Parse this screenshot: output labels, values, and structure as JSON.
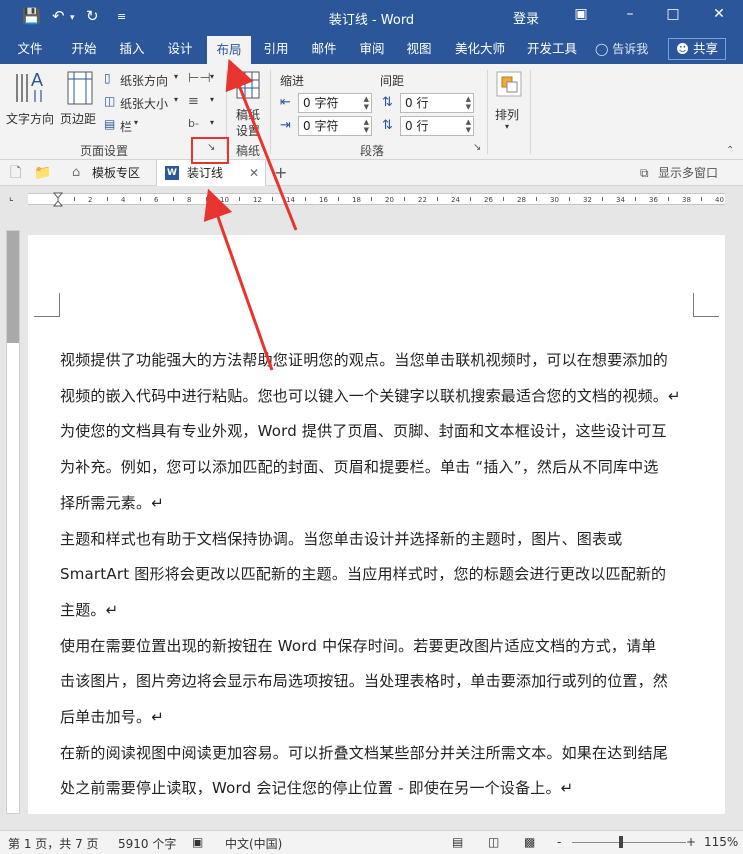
{
  "window": {
    "title": "装订线 - Word",
    "login": "登录",
    "quick_access": {
      "save_icon": "save-icon",
      "undo_icon": "undo-icon",
      "redo_icon": "redo-icon",
      "customize": "customize-icon"
    }
  },
  "tabs": [
    "文件",
    "开始",
    "插入",
    "设计",
    "布局",
    "引用",
    "邮件",
    "审阅",
    "视图",
    "美化大师",
    "开发工具"
  ],
  "active_tab": "布局",
  "tell_me": "告诉我",
  "share": "共享",
  "ribbon": {
    "page_setup": {
      "text_direction": "文字方向",
      "margins": "页边距",
      "orientation": "纸张方向",
      "size": "纸张大小",
      "columns": "栏",
      "group_label": "页面设置"
    },
    "draft": {
      "label_1": "稿纸",
      "label_2": "设置",
      "group_label": "稿纸"
    },
    "paragraph": {
      "indent_label": "缩进",
      "spacing_label": "间距",
      "indent_left": "0 字符",
      "indent_right": "0 字符",
      "spacing_before": "0 行",
      "spacing_after": "0 行",
      "group_label": "段落"
    },
    "arrange": {
      "label": "排列"
    }
  },
  "doc_tabs": {
    "template_zone": "模板专区",
    "current_doc": "装订线",
    "show_multi": "显示多窗口"
  },
  "document": {
    "paragraphs": [
      [
        "视频提供了功能强大的方法帮助您证明您的观点。当您单击联机视频时，可以在想要添加的",
        "视频的嵌入代码中进行粘贴。您也可以键入一个关键字以联机搜索最适合您的文档的视频。↵"
      ],
      [
        "为使您的文档具有专业外观，Word 提供了页眉、页脚、封面和文本框设计，这些设计可互",
        "为补充。例如，您可以添加匹配的封面、页眉和提要栏。单击 “插入”，然后从不同库中选",
        "择所需元素。↵"
      ],
      [
        "主题和样式也有助于文档保持协调。当您单击设计并选择新的主题时，图片、图表或",
        "SmartArt 图形将会更改以匹配新的主题。当应用样式时，您的标题会进行更改以匹配新的",
        "主题。↵"
      ],
      [
        "使用在需要位置出现的新按钮在 Word 中保存时间。若要更改图片适应文档的方式，请单",
        "击该图片，图片旁边将会显示布局选项按钮。当处理表格时，单击要添加行或列的位置，然",
        "后单击加号。↵"
      ],
      [
        "在新的阅读视图中阅读更加容易。可以折叠文档某些部分并关注所需文本。如果在达到结尾",
        "处之前需要停止读取，Word 会记住您的停止位置 - 即使在另一个设备上。↵"
      ]
    ]
  },
  "status": {
    "page": "第 1 页，共 7 页",
    "words": "5910 个字",
    "language": "中文(中国)",
    "zoom": "115%",
    "minus": "-",
    "plus": "+"
  },
  "colors": {
    "accent": "#2b579a",
    "annotation": "#e8342f"
  }
}
